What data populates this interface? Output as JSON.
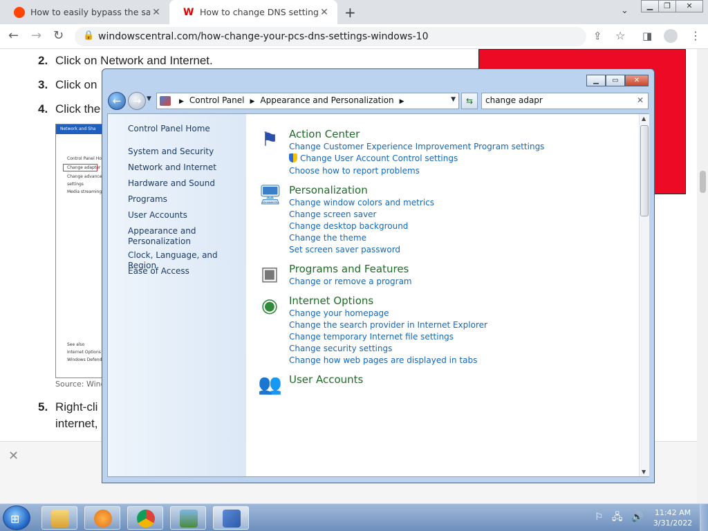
{
  "browser": {
    "tabs": [
      {
        "title": "How to easily bypass the safesea",
        "icon": "reddit-icon"
      },
      {
        "title": "How to change DNS settings on",
        "icon": "windows-central-icon"
      }
    ],
    "url": "windowscentral.com/how-change-your-pcs-dns-settings-windows-10"
  },
  "article": {
    "steps": [
      {
        "num": "2.",
        "text": "Click on Network and Internet."
      },
      {
        "num": "3.",
        "text": "Click on"
      },
      {
        "num": "4.",
        "text": "Click the"
      },
      {
        "num": "5.",
        "text": "Right-cli"
      }
    ],
    "step5_line2": "internet,",
    "source": "Source: Wind",
    "thumbnail": {
      "title": "Network and Sha",
      "items": [
        "Control Panel Ho",
        "Change adapter s",
        "Change advance",
        "settings",
        "Media streaming"
      ],
      "see_also": "See also",
      "bottom_items": [
        "Internet Options",
        "Windows Defend"
      ]
    }
  },
  "cp": {
    "breadcrumbs": [
      "Control Panel",
      "Appearance and Personalization"
    ],
    "search_value": "change adapr",
    "left_links": [
      "Control Panel Home",
      "System and Security",
      "Network and Internet",
      "Hardware and Sound",
      "Programs",
      "User Accounts",
      "Appearance and Personalization",
      "Clock, Language, and Region",
      "Ease of Access"
    ],
    "sections": [
      {
        "title": "Action Center",
        "tasks": [
          "Change Customer Experience Improvement Program settings",
          "Change User Account Control settings",
          "Choose how to report problems"
        ]
      },
      {
        "title": "Personalization",
        "tasks": [
          "Change window colors and metrics",
          "Change screen saver",
          "Change desktop background",
          "Change the theme",
          "Set screen saver password"
        ]
      },
      {
        "title": "Programs and Features",
        "tasks": [
          "Change or remove a program"
        ]
      },
      {
        "title": "Internet Options",
        "tasks": [
          "Change your homepage",
          "Change the search provider in Internet Explorer",
          "Change temporary Internet file settings",
          "Change security settings",
          "Change how web pages are displayed in tabs"
        ]
      },
      {
        "title": "User Accounts",
        "tasks": []
      }
    ]
  },
  "taskbar": {
    "time": "11:42 AM",
    "date": "3/31/2022"
  },
  "colors": {
    "link": "#1566b8",
    "section_heading": "#1e6b26",
    "ad_red": "#ec0a24"
  }
}
